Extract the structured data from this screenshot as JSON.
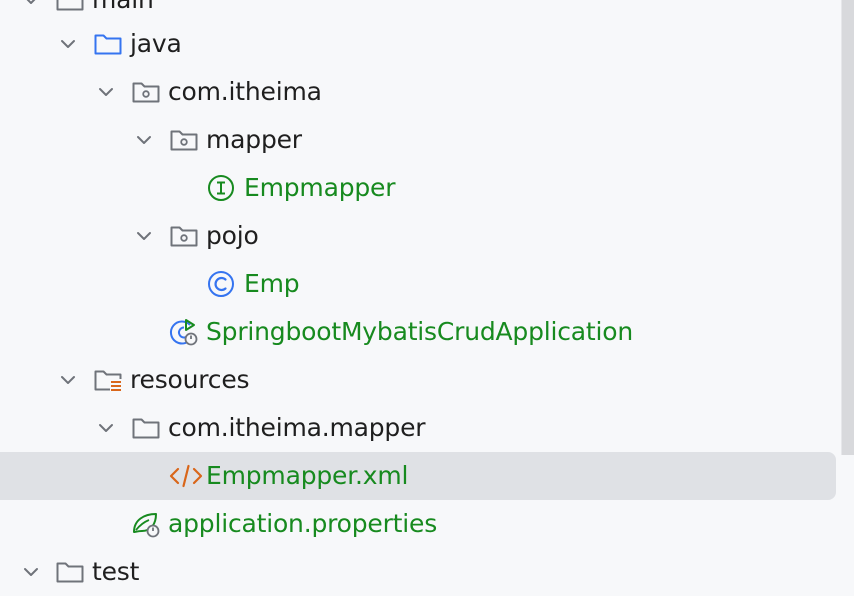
{
  "colors": {
    "background": "#f7f8fa",
    "selected_row": "#dfe1e5",
    "text_default": "#1f1f1f",
    "text_green": "#178a1f",
    "icon_gray": "#6f737a",
    "icon_blue": "#3574f0",
    "icon_orange": "#d9661a",
    "icon_green": "#178a1f"
  },
  "tree": [
    {
      "label": "main",
      "icon": "folder-icon",
      "expanded": true,
      "selected": false,
      "text_color": "default"
    },
    {
      "label": "java",
      "icon": "source-folder-icon",
      "expanded": true,
      "selected": false,
      "text_color": "default"
    },
    {
      "label": "com.itheima",
      "icon": "package-icon",
      "expanded": true,
      "selected": false,
      "text_color": "default"
    },
    {
      "label": "mapper",
      "icon": "package-icon",
      "expanded": true,
      "selected": false,
      "text_color": "default"
    },
    {
      "label": "Empmapper",
      "icon": "interface-icon",
      "expanded": null,
      "selected": false,
      "text_color": "green"
    },
    {
      "label": "pojo",
      "icon": "package-icon",
      "expanded": true,
      "selected": false,
      "text_color": "default"
    },
    {
      "label": "Emp",
      "icon": "class-icon",
      "expanded": null,
      "selected": false,
      "text_color": "green"
    },
    {
      "label": "SpringbootMybatisCrudApplication",
      "icon": "spring-boot-app-icon",
      "expanded": null,
      "selected": false,
      "text_color": "green"
    },
    {
      "label": "resources",
      "icon": "resources-folder-icon",
      "expanded": true,
      "selected": false,
      "text_color": "default"
    },
    {
      "label": "com.itheima.mapper",
      "icon": "folder-icon",
      "expanded": true,
      "selected": false,
      "text_color": "default"
    },
    {
      "label": "Empmapper.xml",
      "icon": "xml-file-icon",
      "expanded": null,
      "selected": true,
      "text_color": "green"
    },
    {
      "label": "application.properties",
      "icon": "spring-properties-icon",
      "expanded": null,
      "selected": false,
      "text_color": "green"
    },
    {
      "label": "test",
      "icon": "folder-icon",
      "expanded": true,
      "selected": false,
      "text_color": "default"
    }
  ]
}
